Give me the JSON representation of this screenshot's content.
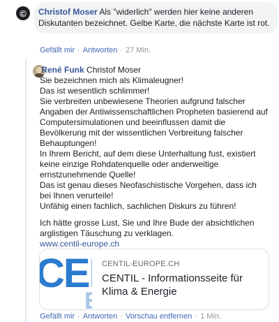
{
  "comment1": {
    "avatar_glyph": "©",
    "author": "Christof Moser",
    "text": "Als \"widerlich\" werden hier keine anderen Diskutanten bezeichnet. Gelbe Karte, die nächste Karte ist rot.",
    "actions": {
      "like": "Gefällt mir",
      "reply": "Antworten",
      "time": "27 Min."
    }
  },
  "reply": {
    "author": "René Funk",
    "mention": "Christof Moser",
    "lines": [
      "Sie bezeichnen mich als Klimaleugner!",
      "Das ist wesentlich schlimmer!",
      "Sie verbreiten unbewiesene Theorien aufgrund falscher Angaben der Antiwissenschaftlichen Propheten basierend auf Computersimulationen und beeinflussen damit die Bevölkerung mit der wissentlichen Verbreitung falscher Behauptungen!",
      "In Ihrem Bericht, auf dem diese Unterhaltung fust, existiert keine einzige Rohdatenquelle oder anderweitige ernstzunehmende Quelle!",
      "Das ist genau dieses Neofaschistische Vorgehen, dass ich bei Ihnen verurteile!",
      "Unfähig einen fachlich, sachlichen Diskurs zu führen!"
    ],
    "closing": "Ich hätte grosse Lust, Sie und Ihre Bude der absichtlichen arglistigen Täuschung zu verklagen.",
    "link": "www.centil-europe.ch",
    "preview": {
      "logo": "CENTIL",
      "logo_sub": "E",
      "domain": "CENTIL-EUROPE.CH",
      "title": "CENTIL - Informationsseite für Klima & Energie"
    },
    "actions": {
      "like": "Gefällt mir",
      "reply": "Antworten",
      "remove_preview": "Vorschau entfernen",
      "time": "1 Min."
    }
  }
}
